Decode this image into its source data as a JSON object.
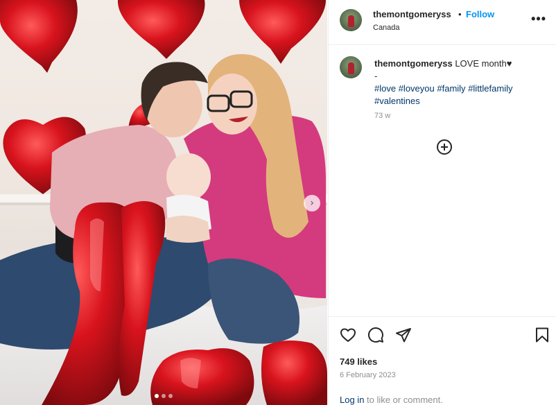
{
  "post": {
    "username": "themontgomeryss",
    "separator": "•",
    "follow_label": "Follow",
    "location": "Canada",
    "more_label": "•••",
    "next_label": "›"
  },
  "caption": {
    "username": "themontgomeryss",
    "text": "LOVE month♥",
    "dash": "-",
    "hashtags": [
      "#love",
      "#loveyou",
      "#family",
      "#littlefamily",
      "#valentines"
    ],
    "age": "73 w"
  },
  "stats": {
    "likes": "749 likes",
    "date": "6 February 2023"
  },
  "login": {
    "link": "Log in",
    "rest": " to like or comment."
  },
  "carousel": {
    "slide_count": 3,
    "active_index": 0
  },
  "icons": {
    "like": "heart-icon",
    "comment": "comment-icon",
    "share": "share-icon",
    "save": "bookmark-icon",
    "add_comment": "add-circle-icon",
    "more": "more-options-icon"
  },
  "colors": {
    "follow": "#0095f6",
    "hashtag": "#00376b",
    "balloon": "#d8131d"
  }
}
